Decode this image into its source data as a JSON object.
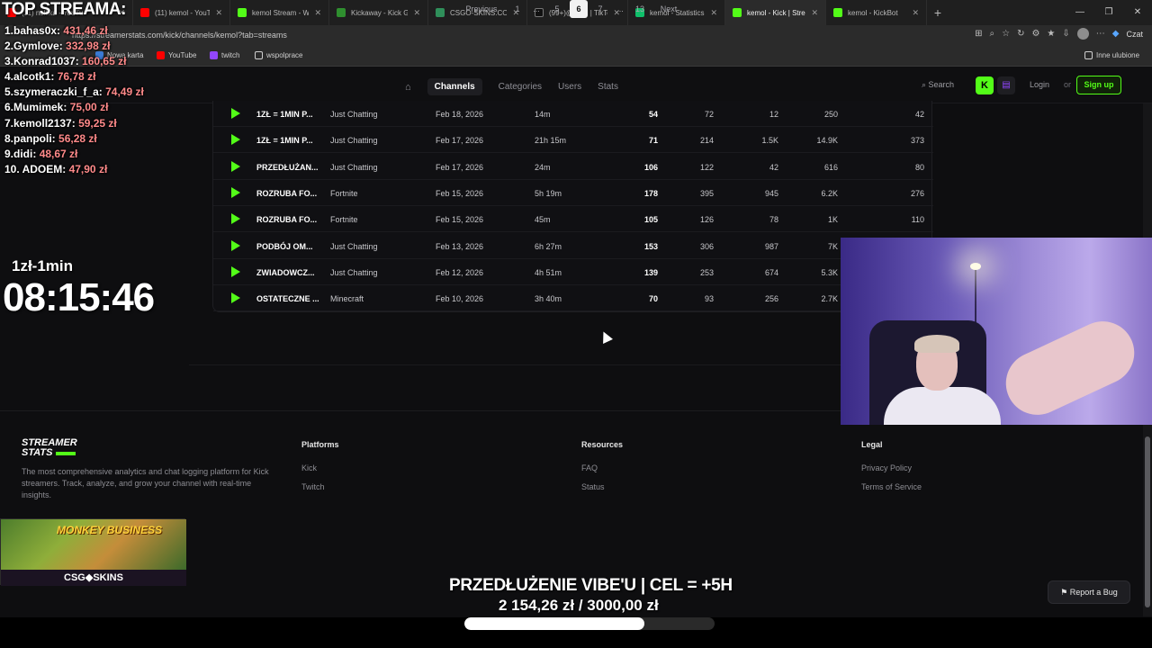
{
  "browser": {
    "tabs": [
      {
        "label": "(11) nolifka - YouTu",
        "color": "#ff0000"
      },
      {
        "label": "(11) kemol - YouTu",
        "color": "#ff0000"
      },
      {
        "label": "kemol Stream - Wat",
        "color": "#53fc18"
      },
      {
        "label": "Kickaway - Kick Giv",
        "color": "#2f8f2f"
      },
      {
        "label": "CSGO-SKINS.COM",
        "color": "#2f8f5a"
      },
      {
        "label": "(99+)@Pafu | TikTok",
        "color": "#111111"
      },
      {
        "label": "kemol - Statistics - T",
        "color": "#0fbf6a"
      },
      {
        "label": "kemol - Kick | Strea",
        "color": "#53fc18"
      },
      {
        "label": "kemol - KickBot",
        "color": "#53fc18"
      }
    ],
    "url": "https://streamerstats.com/kick/channels/kemol?tab=streams",
    "czat": "Czat",
    "bookmarks": [
      "Nowa karta",
      "YouTube",
      "twitch",
      "wspolprace"
    ],
    "other_bookmarks": "Inne ulubione"
  },
  "site": {
    "nav": [
      "Channels",
      "Categories",
      "Users",
      "Stats"
    ],
    "search": "Search",
    "login": "Login",
    "or": "or",
    "signup": "Sign up",
    "kick_icon": "K"
  },
  "streams": [
    {
      "title": "1ZŁ = 1MIN P...",
      "category": "Just Chatting",
      "date": "Feb 18, 2026",
      "duration": "14m",
      "peak": "54",
      "avg": "72",
      "messages": "12",
      "total": "250",
      "last": "42"
    },
    {
      "title": "1ZŁ = 1MIN P...",
      "category": "Just Chatting",
      "date": "Feb 17, 2026",
      "duration": "21h 15m",
      "peak": "71",
      "avg": "214",
      "messages": "1.5K",
      "total": "14.9K",
      "last": "373"
    },
    {
      "title": "PRZEDŁUŻAN...",
      "category": "Just Chatting",
      "date": "Feb 17, 2026",
      "duration": "24m",
      "peak": "106",
      "avg": "122",
      "messages": "42",
      "total": "616",
      "last": "80"
    },
    {
      "title": "ROZRUBA FO...",
      "category": "Fortnite",
      "date": "Feb 15, 2026",
      "duration": "5h 19m",
      "peak": "178",
      "avg": "395",
      "messages": "945",
      "total": "6.2K",
      "last": "276"
    },
    {
      "title": "ROZRUBA FO...",
      "category": "Fortnite",
      "date": "Feb 15, 2026",
      "duration": "45m",
      "peak": "105",
      "avg": "126",
      "messages": "78",
      "total": "1K",
      "last": "110"
    },
    {
      "title": "PODBÓJ OM...",
      "category": "Just Chatting",
      "date": "Feb 13, 2026",
      "duration": "6h 27m",
      "peak": "153",
      "avg": "306",
      "messages": "987",
      "total": "7K",
      "last": ""
    },
    {
      "title": "ZWIADOWCZ...",
      "category": "Just Chatting",
      "date": "Feb 12, 2026",
      "duration": "4h 51m",
      "peak": "139",
      "avg": "253",
      "messages": "674",
      "total": "5.3K",
      "last": ""
    },
    {
      "title": "OSTATECZNE ...",
      "category": "Minecraft",
      "date": "Feb 10, 2026",
      "duration": "3h 40m",
      "peak": "70",
      "avg": "93",
      "messages": "256",
      "total": "2.7K",
      "last": ""
    }
  ],
  "pagination": {
    "previous": "Previous",
    "pages": [
      "1",
      "...",
      "5",
      "6",
      "7",
      "...",
      "13"
    ],
    "current": "6",
    "next": "Next"
  },
  "footer": {
    "logo_line1": "STREAMER",
    "logo_line2": "STATS",
    "description": "The most comprehensive analytics and chat logging platform for Kick streamers. Track, analyze, and grow your channel with real-time insights.",
    "platforms": {
      "heading": "Platforms",
      "links": [
        "Kick",
        "Twitch"
      ]
    },
    "resources": {
      "heading": "Resources",
      "links": [
        "FAQ",
        "Status"
      ]
    },
    "legal": {
      "heading": "Legal",
      "links": [
        "Privacy Policy",
        "Terms of Service"
      ]
    },
    "report_bug": "Report a Bug"
  },
  "overlay": {
    "title": "TOP STREAMA:",
    "donors": [
      {
        "name": "1.bahas0x:",
        "amount": "431,46 zł"
      },
      {
        "name": "2.Gymlove:",
        "amount": "332,98 zł"
      },
      {
        "name": "3.Konrad1037:",
        "amount": "160,65 zł"
      },
      {
        "name": "4.alcotk1:",
        "amount": "76,78 zł"
      },
      {
        "name": "5.szymeraczki_f_a:",
        "amount": "74,49 zł"
      },
      {
        "name": "6.Mumimek:",
        "amount": "75,00 zł"
      },
      {
        "name": "7.kemoll2137:",
        "amount": "59,25 zł"
      },
      {
        "name": "8.panpoli:",
        "amount": "56,28 zł"
      },
      {
        "name": "9.didi:",
        "amount": "48,67 zł"
      },
      {
        "name": "10. ADOEM:",
        "amount": "47,90 zł"
      }
    ],
    "timer_label": "1zł-1min",
    "timer": "08:15:46",
    "ad_text": "MONKEY BUSINESS",
    "ad_brand": "CSG◆SKINS",
    "goal_title": "PRZEDŁUŻENIE VIBE'U | CEL = +5H",
    "goal_amount": "2 154,26 zł / 3000,00 zł",
    "goal_progress": 0.718
  },
  "colors": {
    "accent": "#53fc18",
    "donor_amount": "#ff8a8a"
  }
}
